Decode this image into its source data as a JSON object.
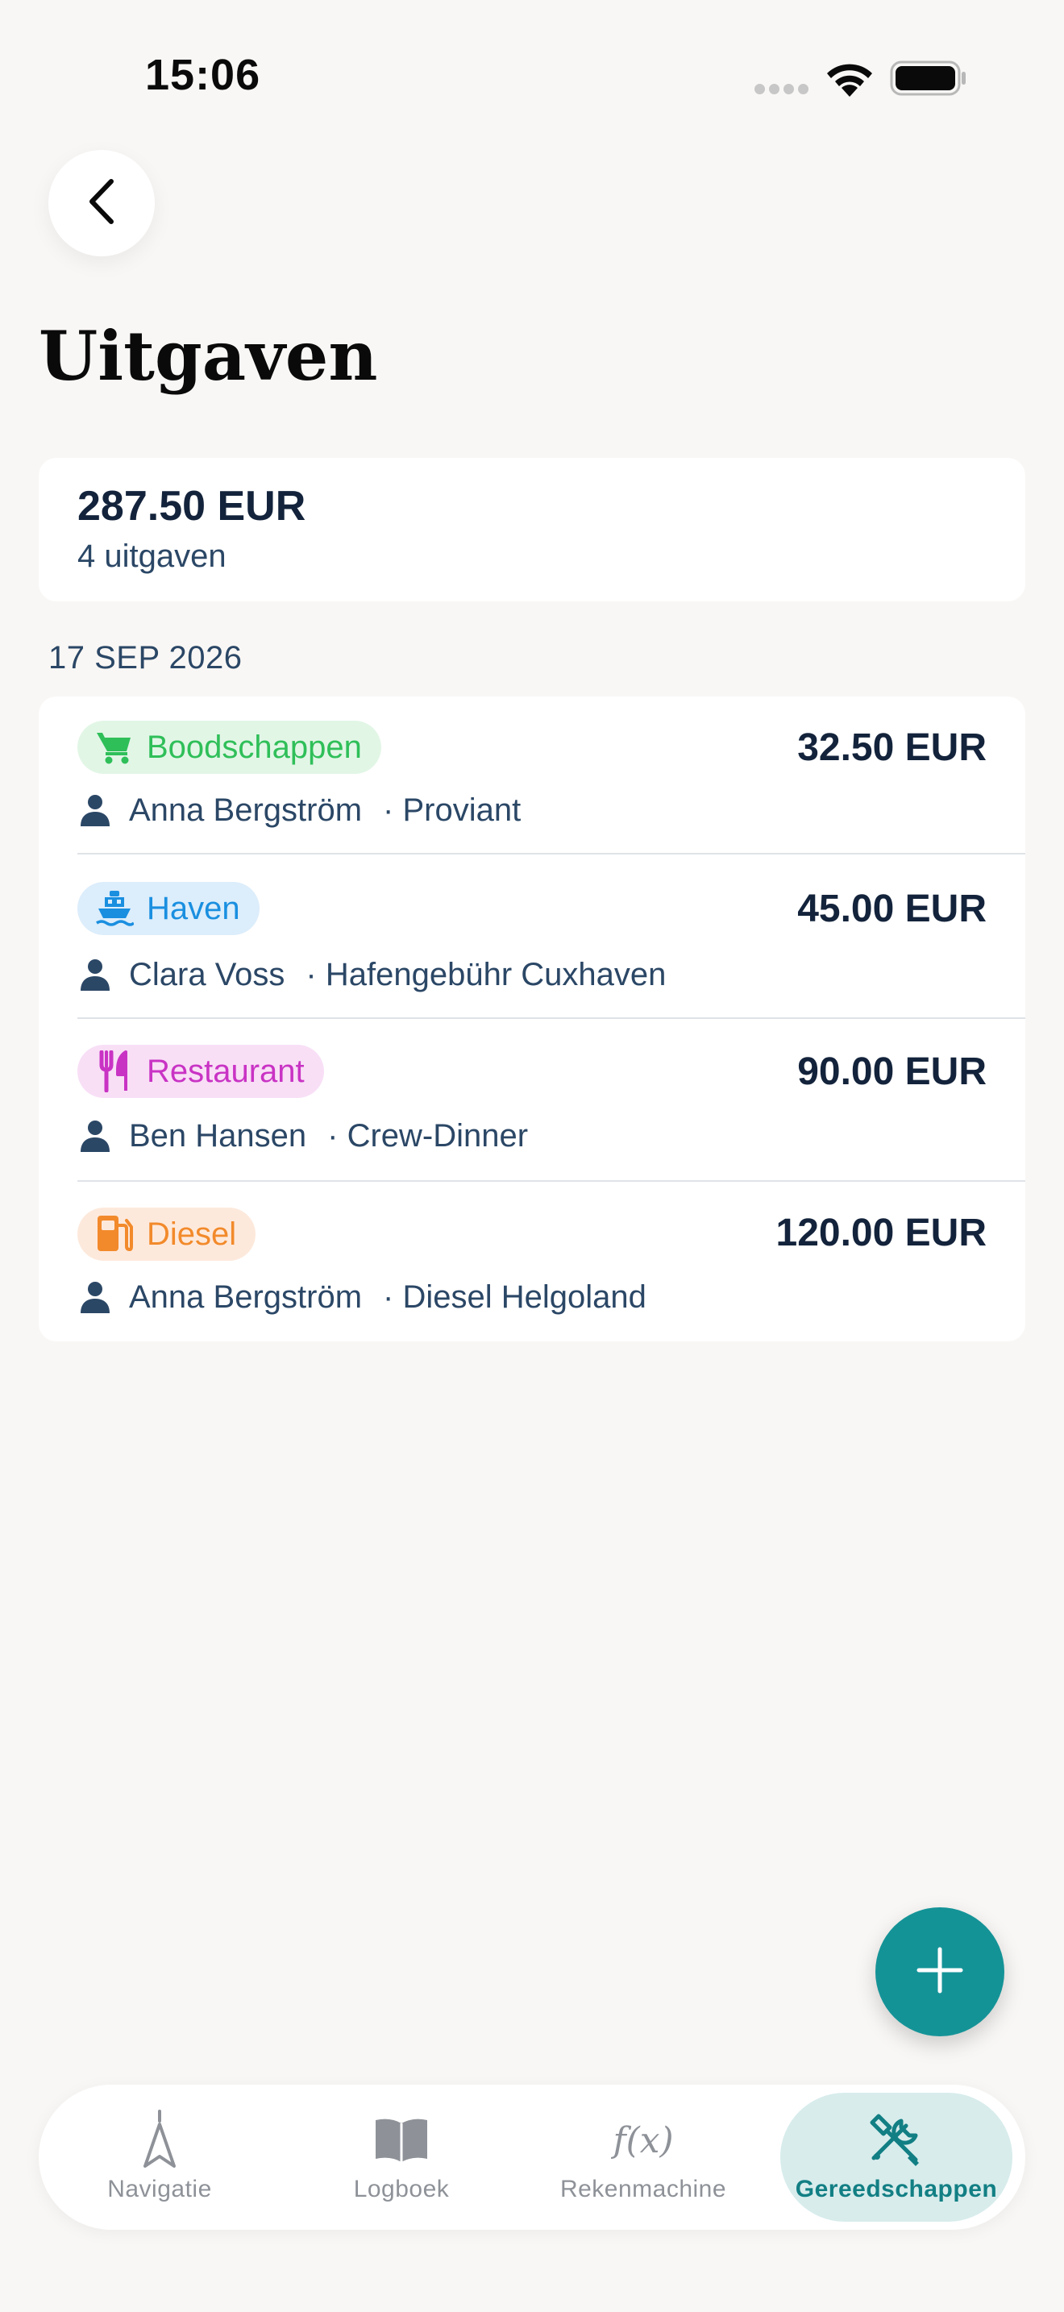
{
  "status_bar": {
    "time": "15:06"
  },
  "header": {
    "back_icon": "chevron-left-icon",
    "title": "Uitgaven"
  },
  "summary": {
    "total": "287.50 EUR",
    "count": "4 uitgaven"
  },
  "date_group": "17 SEP 2026",
  "expenses": [
    {
      "category": "Boodschappen",
      "icon": "cart-icon",
      "chip_bg": "#e2f6e6",
      "chip_color": "#2fbf59",
      "amount": "32.50 EUR",
      "person": "Anna Bergström",
      "description": "· Proviant"
    },
    {
      "category": "Haven",
      "icon": "ferry-icon",
      "chip_bg": "#dcedfb",
      "chip_color": "#1a8fe0",
      "amount": "45.00 EUR",
      "person": "Clara Voss",
      "description": "· Hafengebühr Cuxhaven"
    },
    {
      "category": "Restaurant",
      "icon": "fork-knife-icon",
      "chip_bg": "#f8dff6",
      "chip_color": "#c933c4",
      "amount": "90.00 EUR",
      "person": "Ben Hansen",
      "description": "· Crew-Dinner"
    },
    {
      "category": "Diesel",
      "icon": "fuel-pump-icon",
      "chip_bg": "#fde9dc",
      "chip_color": "#f28a2b",
      "amount": "120.00 EUR",
      "person": "Anna Bergström",
      "description": "· Diesel Helgoland"
    }
  ],
  "fab": {
    "icon": "plus-icon"
  },
  "tab_bar": {
    "active_index": 3,
    "active_color": "#127f84",
    "tabs": [
      {
        "label": "Navigatie",
        "icon": "compass-arrow-icon"
      },
      {
        "label": "Logboek",
        "icon": "book-icon"
      },
      {
        "label": "Rekenmachine",
        "icon": "function-icon"
      },
      {
        "label": "Gereedschappen",
        "icon": "tools-icon"
      }
    ]
  },
  "colors": {
    "background": "#f9f7f5",
    "card": "#ffffff",
    "text_primary": "#13233b",
    "text_secondary": "#2b4766",
    "accent": "#149397"
  }
}
